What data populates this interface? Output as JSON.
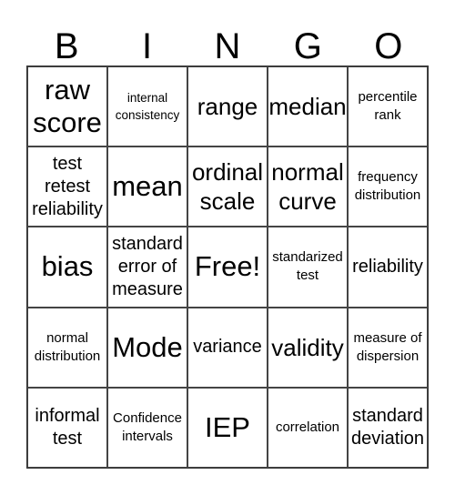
{
  "header": [
    "B",
    "I",
    "N",
    "G",
    "O"
  ],
  "cells": [
    {
      "text": "raw score",
      "size": "xl"
    },
    {
      "text": "internal consistency",
      "size": "xs"
    },
    {
      "text": "range",
      "size": "l"
    },
    {
      "text": "median",
      "size": "l"
    },
    {
      "text": "percentile rank",
      "size": "s"
    },
    {
      "text": "test retest reliability",
      "size": "m"
    },
    {
      "text": "mean",
      "size": "xl"
    },
    {
      "text": "ordinal scale",
      "size": "l"
    },
    {
      "text": "normal curve",
      "size": "l"
    },
    {
      "text": "frequency distribution",
      "size": "s"
    },
    {
      "text": "bias",
      "size": "xl"
    },
    {
      "text": "standard error of measure",
      "size": "m"
    },
    {
      "text": "Free!",
      "size": "xl"
    },
    {
      "text": "standarized test",
      "size": "s"
    },
    {
      "text": "reliability",
      "size": "m"
    },
    {
      "text": "normal distribution",
      "size": "s"
    },
    {
      "text": "Mode",
      "size": "xl"
    },
    {
      "text": "variance",
      "size": "m"
    },
    {
      "text": "validity",
      "size": "l"
    },
    {
      "text": "measure of dispersion",
      "size": "s"
    },
    {
      "text": "informal test",
      "size": "m"
    },
    {
      "text": "Confidence intervals",
      "size": "s"
    },
    {
      "text": "IEP",
      "size": "xl"
    },
    {
      "text": "correlation",
      "size": "s"
    },
    {
      "text": "standard deviation",
      "size": "m"
    }
  ]
}
